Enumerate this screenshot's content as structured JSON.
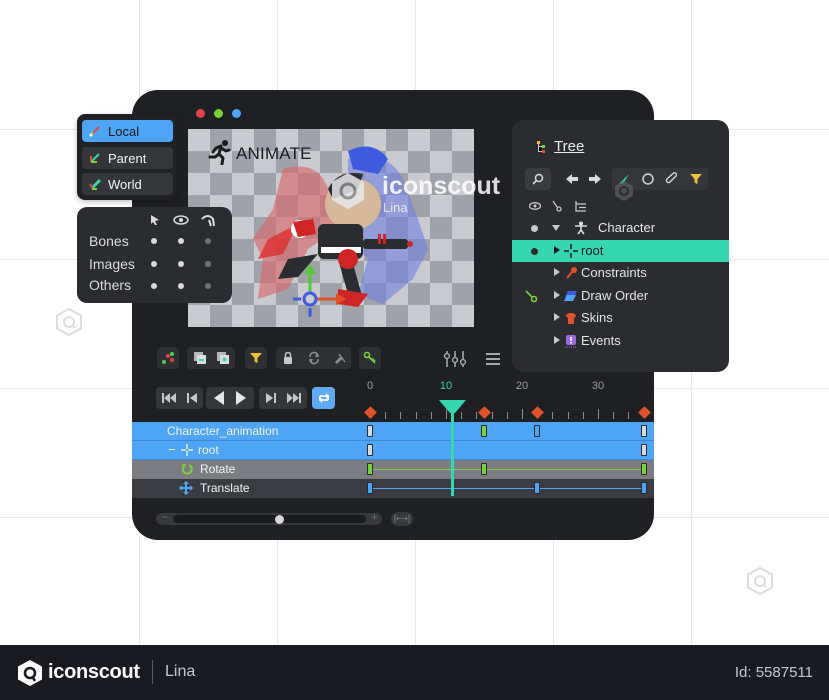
{
  "window": {
    "traffic_lights": [
      {
        "name": "close",
        "color": "#e0444a"
      },
      {
        "name": "minimize",
        "color": "#7ad13a"
      },
      {
        "name": "maximize",
        "color": "#4ea4f5"
      }
    ]
  },
  "viewport": {
    "mode_label": "ANIMATE",
    "mode_icon": "running-figure-icon"
  },
  "coordinate_modes": {
    "items": [
      {
        "label": "Local",
        "icon": "local-axes-icon",
        "active": true
      },
      {
        "label": "Parent",
        "icon": "parent-axes-icon",
        "active": false
      },
      {
        "label": "World",
        "icon": "world-axes-icon",
        "active": false
      }
    ]
  },
  "visibility_panel": {
    "columns": [
      "select-arrow-icon",
      "eye-icon",
      "bone-icon"
    ],
    "rows": [
      {
        "label": "Bones",
        "select": true,
        "visible": true,
        "bone": false
      },
      {
        "label": "Images",
        "select": true,
        "visible": true,
        "bone": false
      },
      {
        "label": "Others",
        "select": true,
        "visible": true,
        "bone": false
      }
    ]
  },
  "tree": {
    "title": "Tree",
    "toolbar": [
      "search-icon",
      "arrow-left-icon",
      "arrow-right-icon",
      "bone-tool-icon",
      "circle-icon",
      "paperclip-icon",
      "filter-icon"
    ],
    "column_icons": [
      "eye-icon",
      "key-icon",
      "hierarchy-icon"
    ],
    "nodes": [
      {
        "label": "Character",
        "icon": "character-icon",
        "expanded": true,
        "dot": true,
        "selected": false,
        "key": false
      },
      {
        "label": "root",
        "icon": "root-bone-icon",
        "expanded": false,
        "dot": true,
        "selected": true,
        "key": false
      },
      {
        "label": "Constraints",
        "icon": "constraints-icon",
        "expanded": false,
        "dot": false,
        "selected": false,
        "key": false
      },
      {
        "label": "Draw Order",
        "icon": "draw-order-icon",
        "expanded": false,
        "dot": false,
        "selected": false,
        "key": true
      },
      {
        "label": "Skins",
        "icon": "skins-icon",
        "expanded": false,
        "dot": false,
        "selected": false,
        "key": false
      },
      {
        "label": "Events",
        "icon": "events-icon",
        "expanded": false,
        "dot": false,
        "selected": false,
        "key": false
      }
    ]
  },
  "toolbar": {
    "tools": [
      "graph-icon",
      "ghost-frame-icon",
      "onion-skin-icon",
      "filter-icon",
      "lock-icon",
      "loop-sync-icon",
      "mute-icon",
      "key-icon"
    ],
    "right_tools": [
      "sliders-icon",
      "menu-icon"
    ]
  },
  "playback": {
    "buttons": [
      "skip-to-start-icon",
      "step-back-icon",
      "play-backward-icon",
      "play-forward-icon",
      "step-forward-icon",
      "skip-to-end-icon",
      "loop-icon"
    ],
    "loop_active": true
  },
  "timeline": {
    "ruler_labels": [
      "0",
      "10",
      "20",
      "30"
    ],
    "current_frame": 10,
    "keyframe_markers": [
      0,
      15,
      22,
      36
    ],
    "tracks": [
      {
        "label": "Character_animation",
        "type": "animation",
        "keys": [
          {
            "frame": 0,
            "color": "#d8d9dc"
          },
          {
            "frame": 15,
            "color": "#7ad13a"
          },
          {
            "frame": 22,
            "color": "#4ea4f5"
          },
          {
            "frame": 36,
            "color": "#d8d9dc"
          }
        ]
      },
      {
        "label": "root",
        "type": "bone",
        "keys": [
          {
            "frame": 0,
            "color": "#d8d9dc"
          },
          {
            "frame": 36,
            "color": "#d8d9dc"
          }
        ]
      },
      {
        "label": "Rotate",
        "type": "rotate",
        "keys": [
          {
            "frame": 0,
            "color": "#7ad13a"
          },
          {
            "frame": 15,
            "color": "#7ad13a"
          },
          {
            "frame": 36,
            "color": "#7ad13a"
          }
        ]
      },
      {
        "label": "Translate",
        "type": "translate",
        "keys": [
          {
            "frame": 0,
            "color": "#4ea4f5"
          },
          {
            "frame": 22,
            "color": "#4ea4f5"
          },
          {
            "frame": 36,
            "color": "#4ea4f5"
          }
        ]
      }
    ],
    "zoom_minus": "−",
    "zoom_plus": "+",
    "zoom_level": 0.55,
    "fit_label": "[⟷]"
  },
  "watermark": {
    "brand": "iconscout",
    "author": "Lina"
  },
  "footer": {
    "brand": "iconscout",
    "author": "Lina",
    "id_label": "Id: 5587511"
  }
}
